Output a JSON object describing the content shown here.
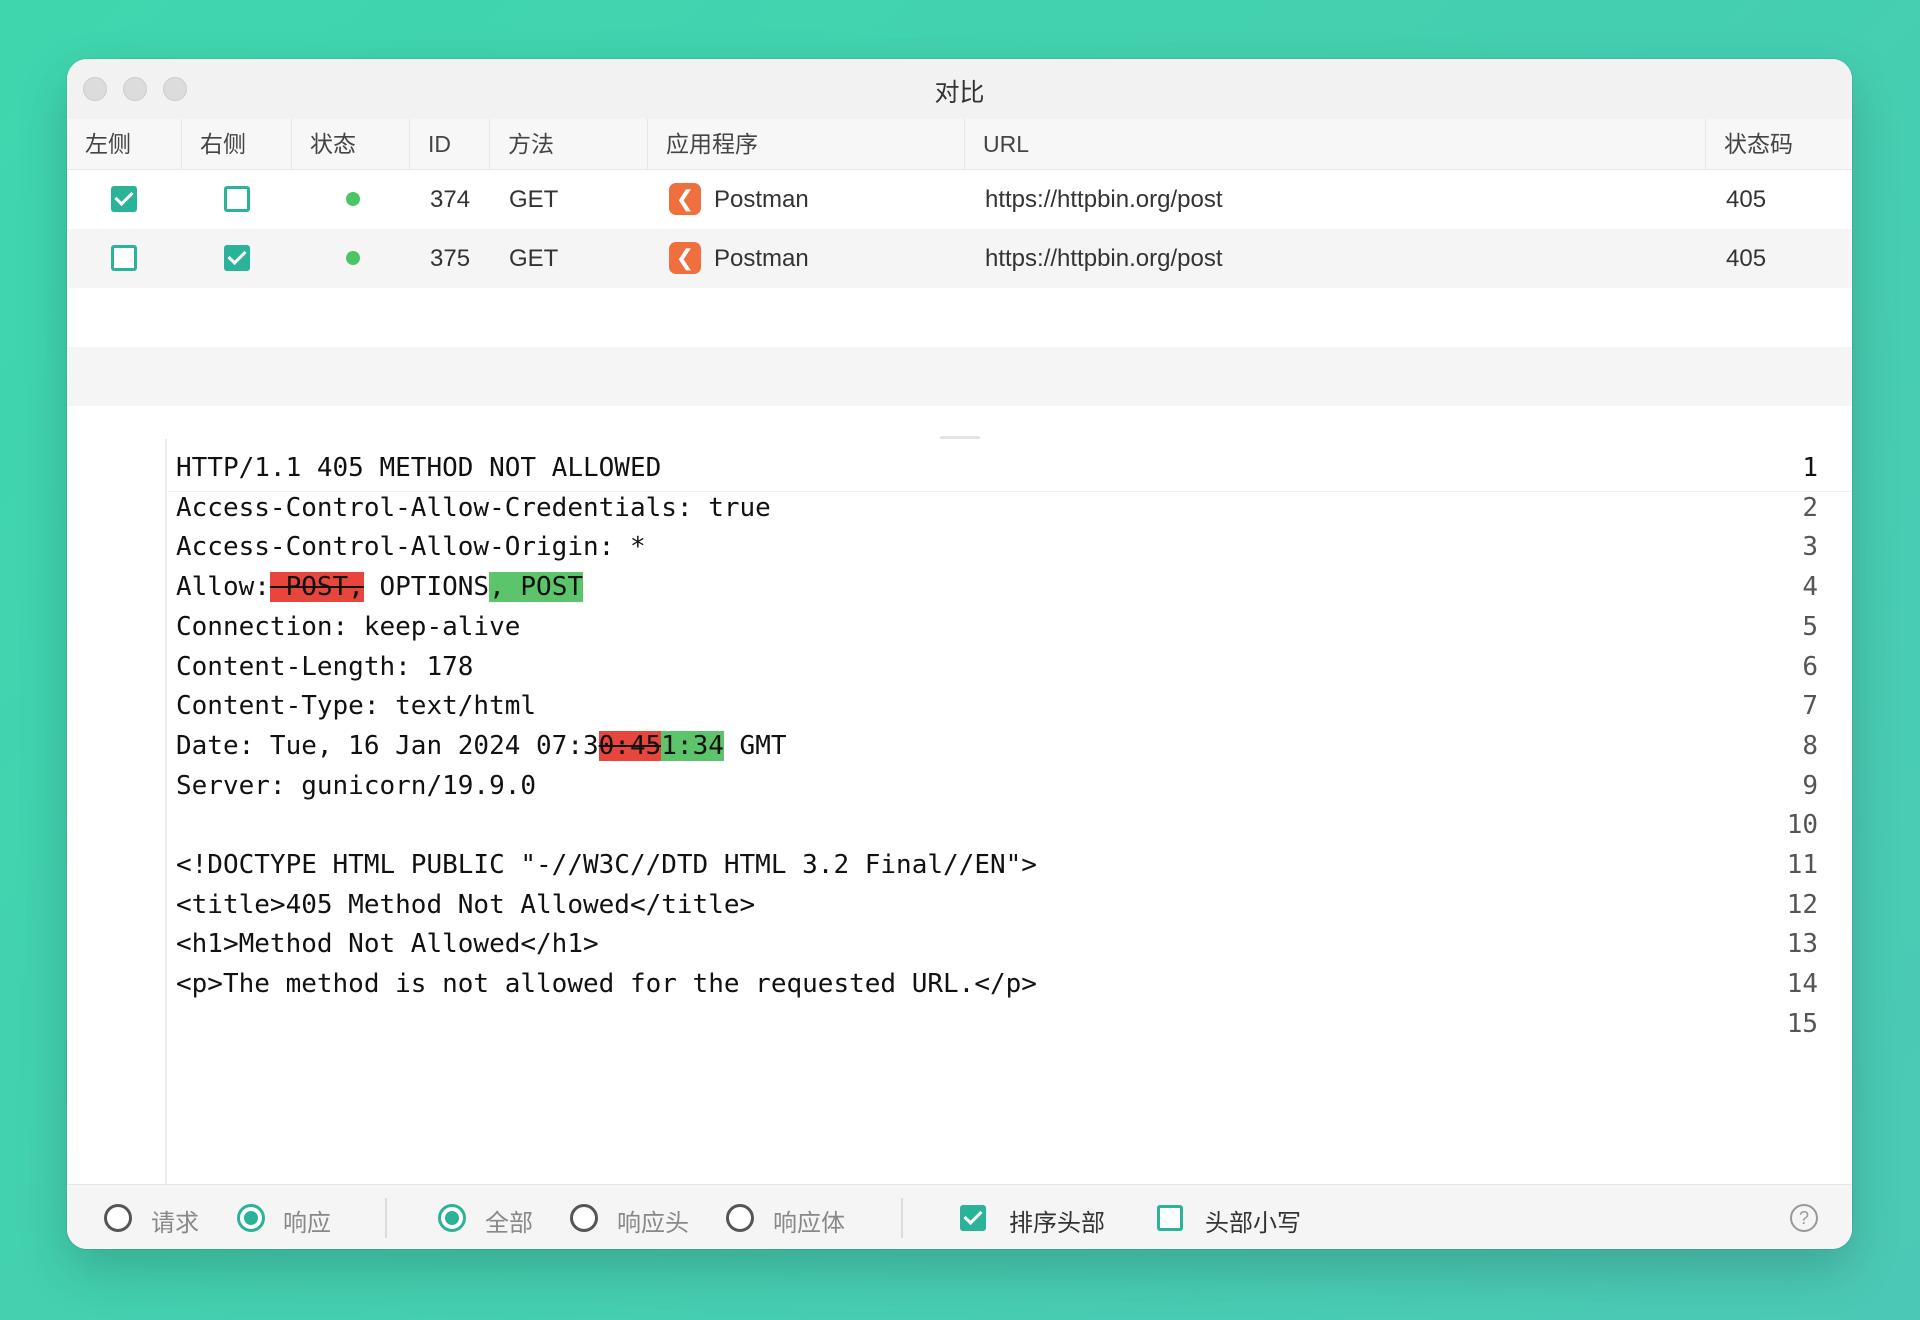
{
  "window": {
    "title": "对比"
  },
  "table": {
    "columns": [
      "左侧",
      "右侧",
      "状态",
      "ID",
      "方法",
      "应用程序",
      "URL",
      "状态码"
    ],
    "rows": [
      {
        "left_checked": true,
        "right_checked": false,
        "id": "374",
        "method": "GET",
        "app": "Postman",
        "url": "https://httpbin.org/post",
        "status_code": "405"
      },
      {
        "left_checked": false,
        "right_checked": true,
        "id": "375",
        "method": "GET",
        "app": "Postman",
        "url": "https://httpbin.org/post",
        "status_code": "405"
      }
    ]
  },
  "editor": {
    "line_numbers": [
      "1",
      "2",
      "3",
      "4",
      "5",
      "6",
      "7",
      "8",
      "9",
      "10",
      "11",
      "12",
      "13",
      "14",
      "15"
    ],
    "lines": {
      "l1": "HTTP/1.1 405 METHOD NOT ALLOWED",
      "l2": "Access-Control-Allow-Credentials: true",
      "l3": "Access-Control-Allow-Origin: *",
      "l4_a": "Allow:",
      "l4_del": " POST,",
      "l4_b": " OPTIONS",
      "l4_add": ", POST",
      "l5": "Connection: keep-alive",
      "l6": "Content-Length: 178",
      "l7": "Content-Type: text/html",
      "l8_a": "Date: Tue, 16 Jan 2024 07:3",
      "l8_del": "0:45",
      "l8_add": "1:34",
      "l8_b": " GMT",
      "l9": "Server: gunicorn/19.9.0",
      "l10": "",
      "l11": "<!DOCTYPE HTML PUBLIC \"-//W3C//DTD HTML 3.2 Final//EN\">",
      "l12": "<title>405 Method Not Allowed</title>",
      "l13": "<h1>Method Not Allowed</h1>",
      "l14": "<p>The method is not allowed for the requested URL.</p>",
      "l15": ""
    }
  },
  "footer": {
    "request_label": "请求",
    "response_label": "响应",
    "all_label": "全部",
    "resp_headers_label": "响应头",
    "resp_body_label": "响应体",
    "sort_headers_label": "排序头部",
    "lowercase_headers_label": "头部小写",
    "help_glyph": "?"
  },
  "colors": {
    "accent": "#2bb39a",
    "deleted": "#e8453c",
    "added": "#5cc46b",
    "status_dot": "#4cc564",
    "app_icon": "#ef6f3e"
  }
}
